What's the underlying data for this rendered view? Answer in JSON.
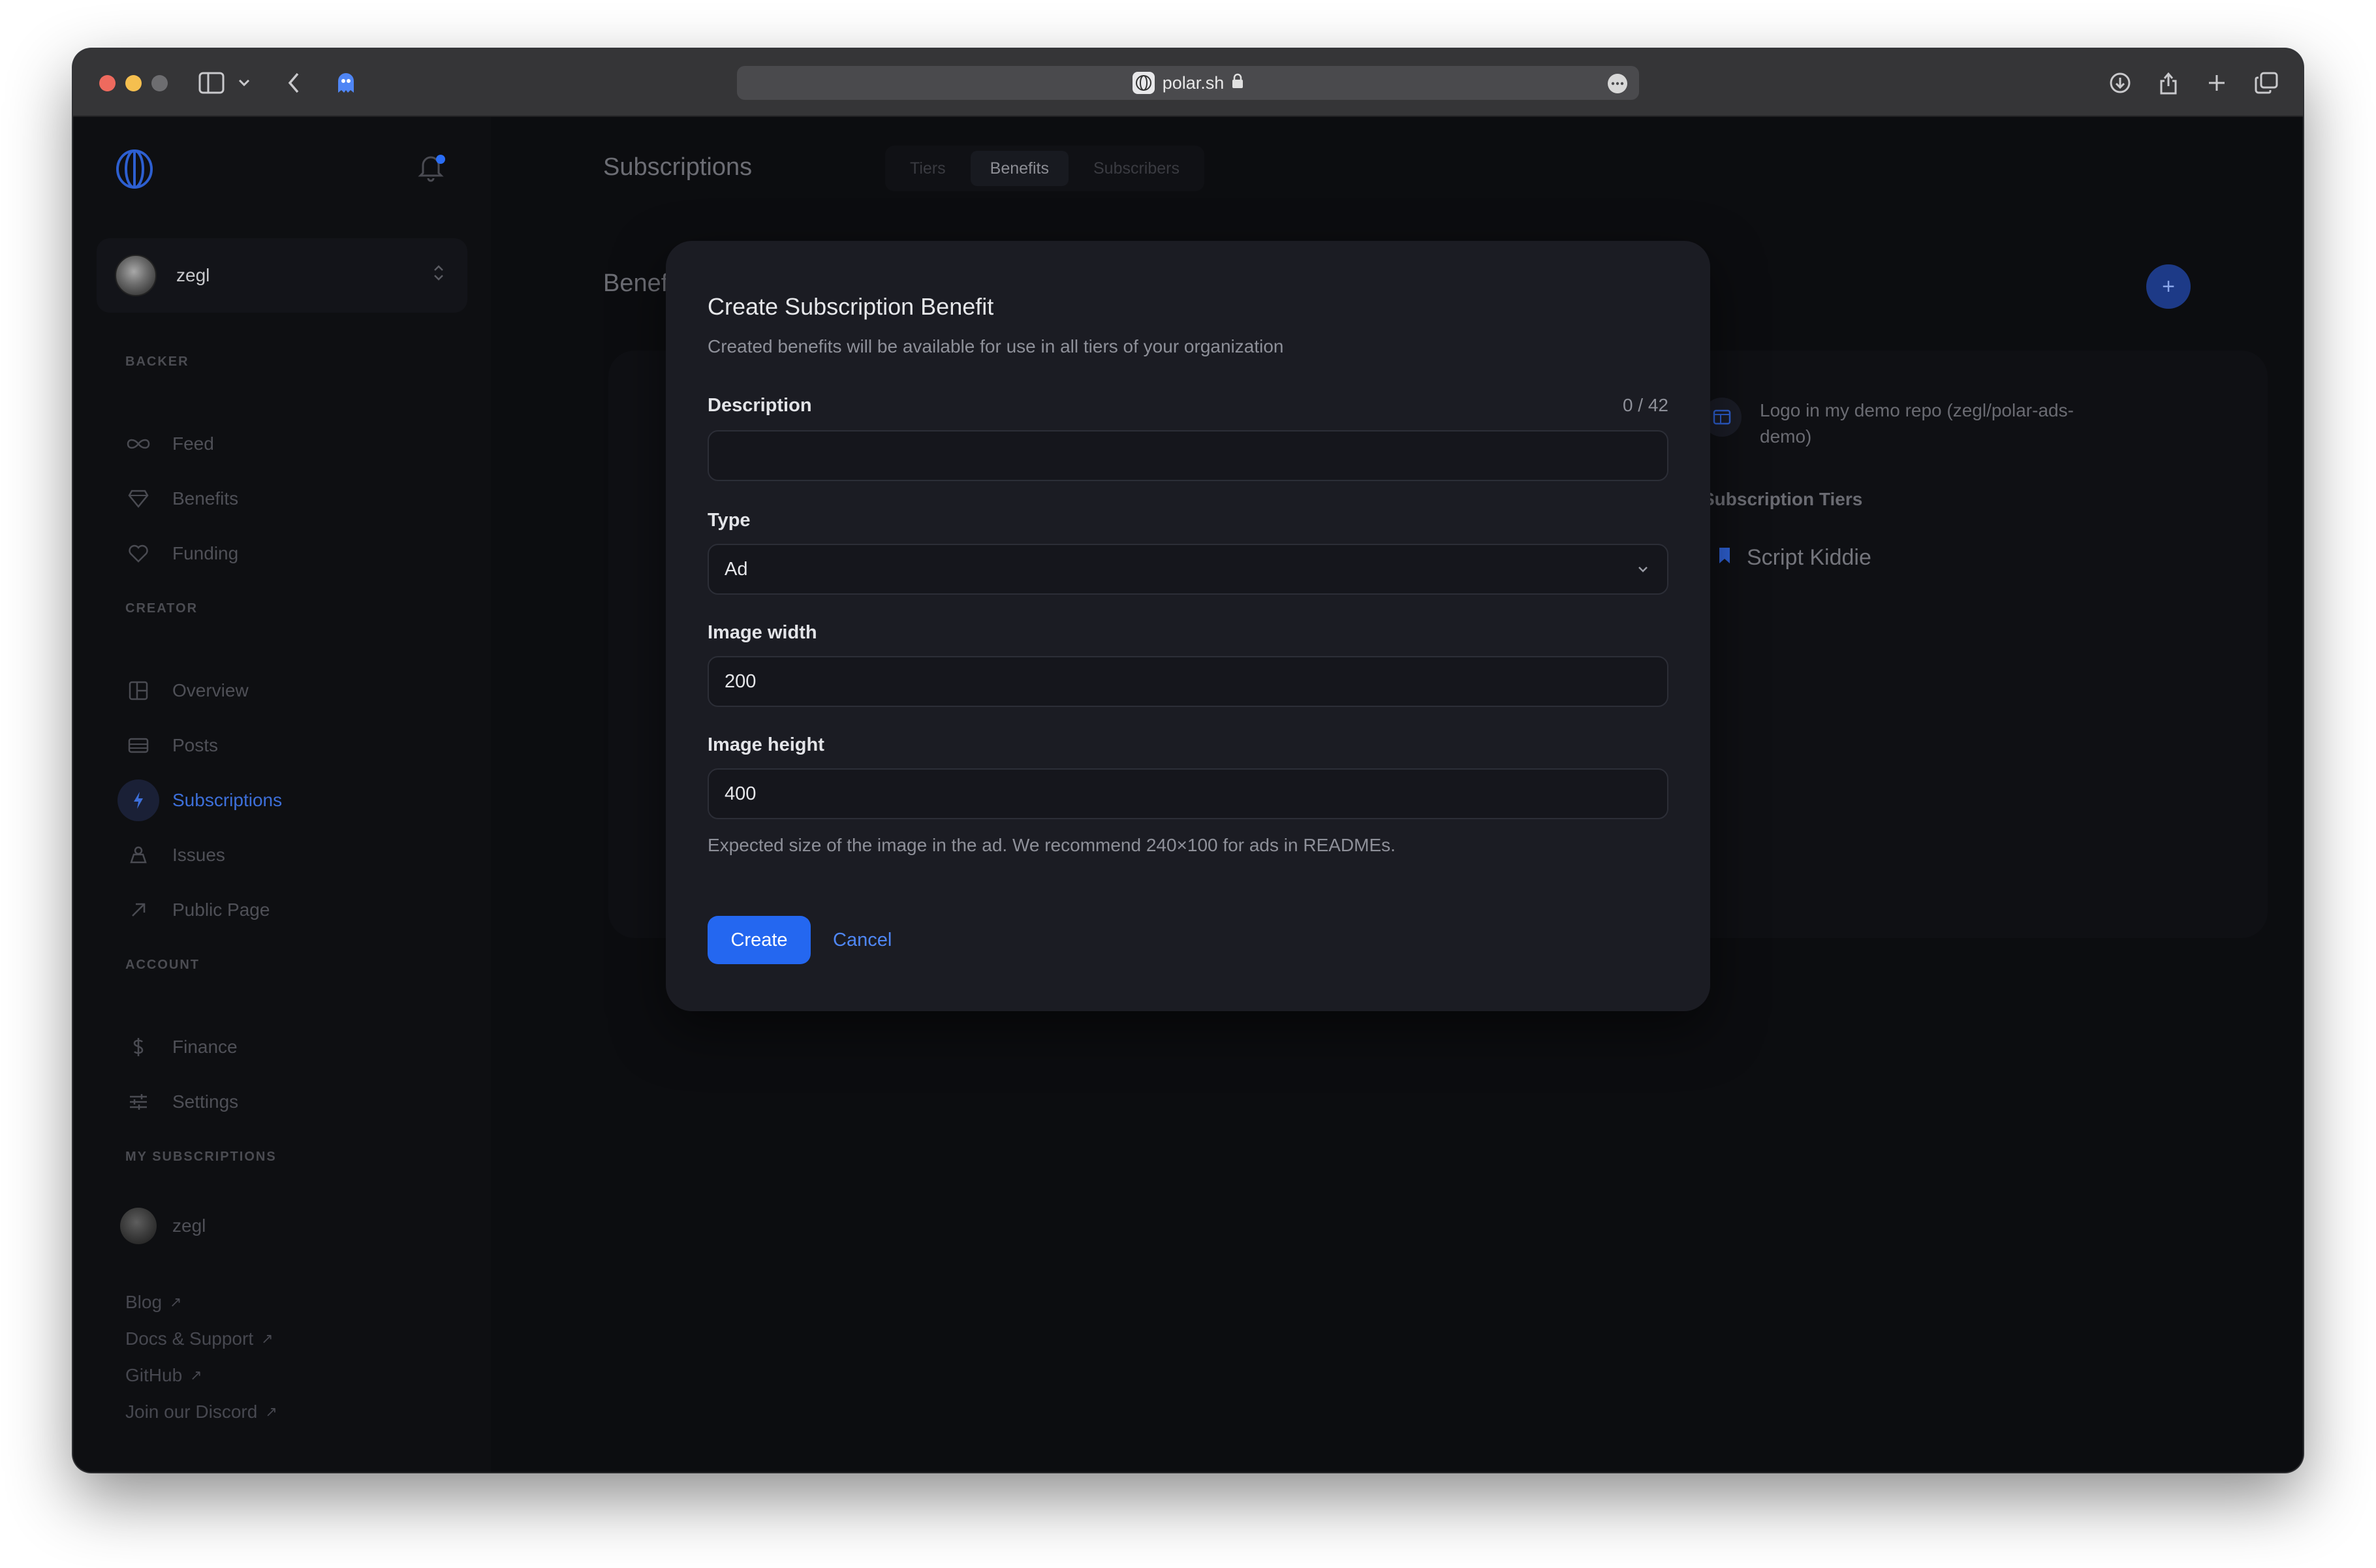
{
  "browser": {
    "url": "polar.sh"
  },
  "sidebar": {
    "account_name": "zegl",
    "sections": {
      "backer": "BACKER",
      "creator": "CREATOR",
      "account": "ACCOUNT",
      "my_subscriptions": "MY SUBSCRIPTIONS"
    },
    "backer_items": [
      {
        "label": "Feed",
        "icon": "infinity-icon"
      },
      {
        "label": "Benefits",
        "icon": "diamond-icon"
      },
      {
        "label": "Funding",
        "icon": "heart-icon"
      }
    ],
    "creator_items": [
      {
        "label": "Overview",
        "icon": "grid-icon"
      },
      {
        "label": "Posts",
        "icon": "posts-icon"
      },
      {
        "label": "Subscriptions",
        "icon": "bolt-icon",
        "active": true
      },
      {
        "label": "Issues",
        "icon": "issues-icon"
      },
      {
        "label": "Public Page",
        "icon": "arrow-up-right-icon"
      }
    ],
    "account_items": [
      {
        "label": "Finance",
        "icon": "dollar-icon"
      },
      {
        "label": "Settings",
        "icon": "sliders-icon"
      }
    ],
    "my_subscriptions": [
      {
        "label": "zegl"
      }
    ],
    "footer_links": [
      "Blog",
      "Docs & Support",
      "GitHub",
      "Join our Discord"
    ]
  },
  "main": {
    "page_title": "Subscriptions",
    "tabs": [
      {
        "label": "Tiers",
        "active": false
      },
      {
        "label": "Benefits",
        "active": true
      },
      {
        "label": "Subscribers",
        "active": false
      }
    ],
    "section_heading": "Benef",
    "benefit_panel": {
      "benefit_description": "Logo in my demo repo (zegl/polar-ads-demo)",
      "tiers_label": "Subscription Tiers",
      "tiers": [
        "Script Kiddie"
      ]
    },
    "add_button": "+"
  },
  "modal": {
    "title": "Create Subscription Benefit",
    "subtitle": "Created benefits will be available for use in all tiers of your organization",
    "description_label": "Description",
    "description_value": "",
    "description_counter": "0 / 42",
    "type_label": "Type",
    "type_value": "Ad",
    "image_width_label": "Image width",
    "image_width_value": "200",
    "image_height_label": "Image height",
    "image_height_value": "400",
    "help_text": "Expected size of the image in the ad. We recommend 240×100 for ads in READMEs.",
    "create_label": "Create",
    "cancel_label": "Cancel"
  },
  "colors": {
    "accent": "#2467f0",
    "modal_bg": "#1b1c23",
    "app_bg": "#0c0d10"
  }
}
